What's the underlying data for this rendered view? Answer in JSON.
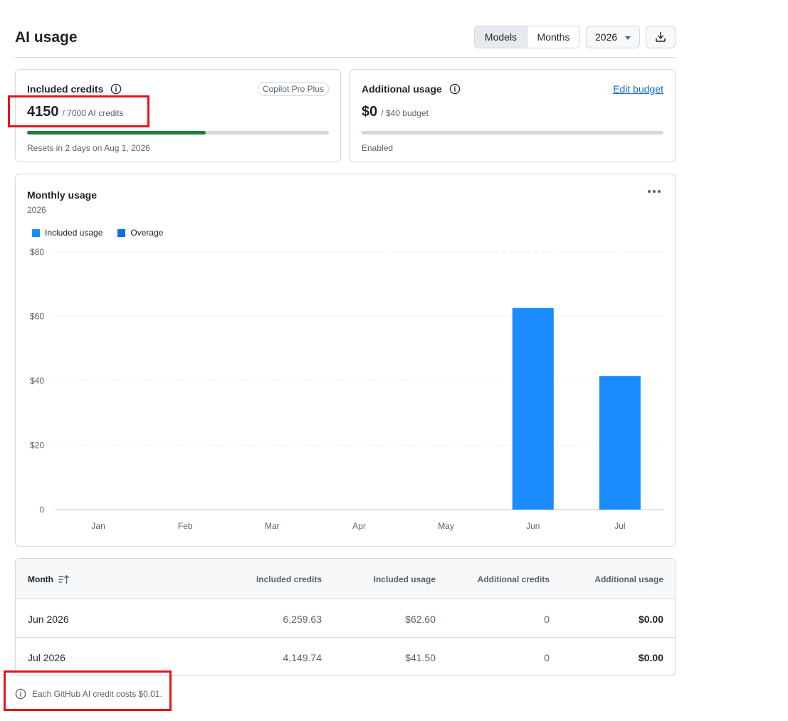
{
  "header": {
    "title": "AI usage",
    "view_toggle": [
      {
        "label": "Models",
        "active": true
      },
      {
        "label": "Months",
        "active": false
      }
    ],
    "year_select": "2026",
    "download_icon": "download-icon"
  },
  "included_credits": {
    "title": "Included credits",
    "info_icon": "info-icon",
    "plan_badge": "Copilot Pro Plus",
    "used": "4150",
    "total_label": "/ 7000 AI credits",
    "progress_fraction": 0.593,
    "progress_color": "#1a7f37",
    "reset_text": "Resets in 2 days on Aug 1, 2026"
  },
  "additional_usage": {
    "title": "Additional usage",
    "info_icon": "info-icon",
    "edit_link": "Edit budget",
    "spent": "$0",
    "budget_label": "/ $40 budget",
    "progress_fraction": 0,
    "status": "Enabled"
  },
  "monthly_usage": {
    "title": "Monthly usage",
    "subtitle": "2026",
    "menu_icon": "kebab-horizontal-icon",
    "legend": [
      {
        "label": "Included usage",
        "color": "#1a8cff"
      },
      {
        "label": "Overage",
        "color": "#0a6fe0"
      }
    ]
  },
  "chart_data": {
    "type": "bar",
    "title": "Monthly usage",
    "subtitle": "2026",
    "categories": [
      "Jan",
      "Feb",
      "Mar",
      "Apr",
      "May",
      "Jun",
      "Jul"
    ],
    "series": [
      {
        "name": "Included usage",
        "values": [
          0,
          0,
          0,
          0,
          0,
          62.6,
          41.5
        ],
        "color": "#1a8cff"
      },
      {
        "name": "Overage",
        "values": [
          0,
          0,
          0,
          0,
          0,
          0,
          0
        ],
        "color": "#0a6fe0"
      }
    ],
    "ylim": [
      0,
      80
    ],
    "yticks": [
      0,
      20,
      40,
      60,
      80
    ],
    "ytick_labels": [
      "0",
      "$20",
      "$40",
      "$60",
      "$80"
    ],
    "stacked": true,
    "grid": true,
    "legend_position": "top-left"
  },
  "table": {
    "columns": [
      "Month",
      "Included credits",
      "Included usage",
      "Additional credits",
      "Additional usage"
    ],
    "sort_icon": "sort-ascending-icon",
    "rows": [
      {
        "month": "Jun 2026",
        "included_credits": "6,259.63",
        "included_usage": "$62.60",
        "additional_credits": "0",
        "additional_usage": "$0.00"
      },
      {
        "month": "Jul 2026",
        "included_credits": "4,149.74",
        "included_usage": "$41.50",
        "additional_credits": "0",
        "additional_usage": "$0.00"
      }
    ]
  },
  "footnote": {
    "icon": "info-icon",
    "text": "Each GitHub AI credit costs $0.01."
  },
  "annotation_color": "#e0151b"
}
